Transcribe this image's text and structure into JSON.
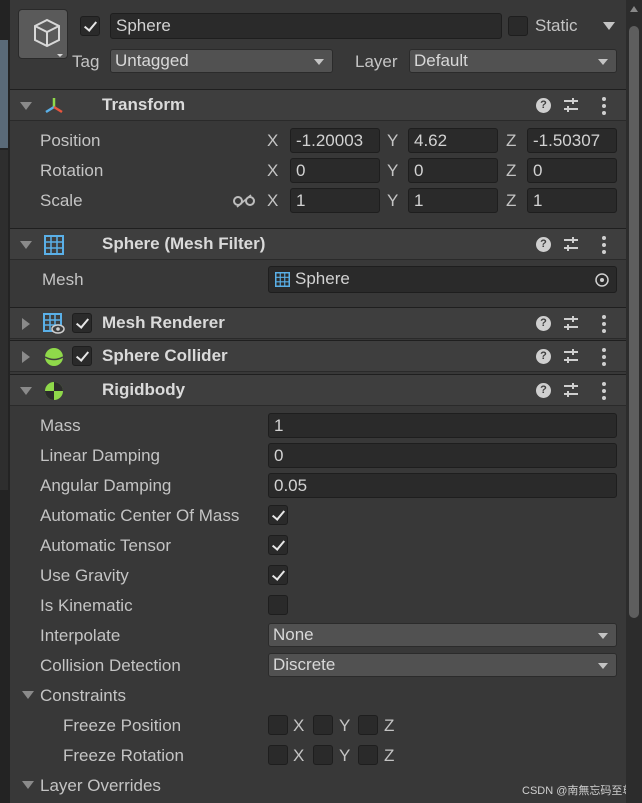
{
  "gameobject": {
    "name": "Sphere",
    "active": true,
    "static_label": "Static",
    "static": false,
    "tag_label": "Tag",
    "tag_value": "Untagged",
    "layer_label": "Layer",
    "layer_value": "Default"
  },
  "transform": {
    "title": "Transform",
    "position_label": "Position",
    "rotation_label": "Rotation",
    "scale_label": "Scale",
    "axis_x": "X",
    "axis_y": "Y",
    "axis_z": "Z",
    "position": {
      "x": "-1.20003",
      "y": "4.62",
      "z": "-1.50307"
    },
    "rotation": {
      "x": "0",
      "y": "0",
      "z": "0"
    },
    "scale": {
      "x": "1",
      "y": "1",
      "z": "1"
    }
  },
  "mesh_filter": {
    "title": "Sphere (Mesh Filter)",
    "mesh_label": "Mesh",
    "mesh_value": "Sphere"
  },
  "mesh_renderer": {
    "title": "Mesh Renderer",
    "enabled": true
  },
  "sphere_collider": {
    "title": "Sphere Collider",
    "enabled": true
  },
  "rigidbody": {
    "title": "Rigidbody",
    "mass_label": "Mass",
    "mass": "1",
    "linear_damping_label": "Linear Damping",
    "linear_damping": "0",
    "angular_damping_label": "Angular Damping",
    "angular_damping": "0.05",
    "auto_center_label": "Automatic Center Of Mass",
    "auto_center": true,
    "auto_tensor_label": "Automatic Tensor",
    "auto_tensor": true,
    "use_gravity_label": "Use Gravity",
    "use_gravity": true,
    "is_kinematic_label": "Is Kinematic",
    "is_kinematic": false,
    "interpolate_label": "Interpolate",
    "interpolate_value": "None",
    "collision_label": "Collision Detection",
    "collision_value": "Discrete",
    "constraints_label": "Constraints",
    "freeze_position_label": "Freeze Position",
    "freeze_rotation_label": "Freeze Rotation",
    "layer_overrides_label": "Layer Overrides"
  },
  "watermark": "CSDN @南無忘码至尊",
  "colors": {
    "background": "#383838",
    "field": "#2a2a2a",
    "header": "#3e3e3e",
    "accent_green": "#8fd94a",
    "grid_blue": "#5ab0e8"
  }
}
